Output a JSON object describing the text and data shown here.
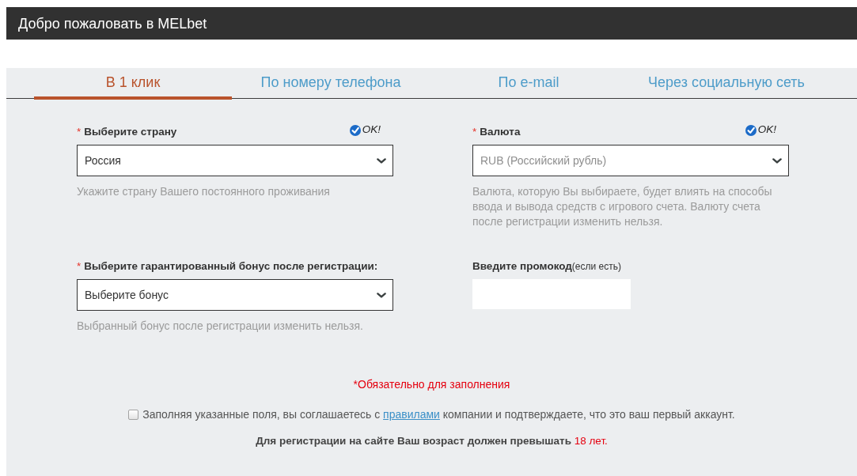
{
  "header": {
    "title": "Добро пожаловать в MELbet"
  },
  "tabs": [
    {
      "label": "В 1 клик",
      "selected": true
    },
    {
      "label": "По номеру телефона",
      "selected": false
    },
    {
      "label": "По e-mail",
      "selected": false
    },
    {
      "label": "Через социальную сеть",
      "selected": false
    }
  ],
  "fields": [
    {
      "kind": "select",
      "required_mark": "*",
      "label": "Выберите страну",
      "valid": true,
      "status_text": "OK!",
      "value": "Россия",
      "disabled": false,
      "help": "Укажите страну Вашего постоянного проживания"
    },
    {
      "kind": "select",
      "required_mark": "*",
      "label": "Валюта",
      "valid": true,
      "status_text": "OK!",
      "value": "RUB (Российский рубль)",
      "disabled": true,
      "help": "Валюта, которую Вы выбираете, будет влиять на способы ввода и вывода средств с игрового счета. Валюту счета после регистрации изменить нельзя."
    },
    {
      "kind": "select",
      "required_mark": "*",
      "label": "Выберите гарантированный бонус после регистрации:",
      "valid": false,
      "value": "Выберите бонус",
      "disabled": false,
      "help": "Выбранный бонус после регистрации изменить нельзя."
    },
    {
      "kind": "text",
      "label": "Введите промокод",
      "label_note": "(если есть)",
      "valid": false,
      "disabled": false
    }
  ],
  "required_note": "*Обязательно для заполнения",
  "agreement": {
    "checked": false,
    "text_before": "Заполняя указанные поля, вы соглашаетесь с",
    "link": "правилами",
    "text_after": "компании и подтверждаете, что это ваш первый аккаунт."
  },
  "age_notice": {
    "text": "Для регистрации на сайте Ваш возраст должен превышать",
    "highlight": "18 лет."
  }
}
